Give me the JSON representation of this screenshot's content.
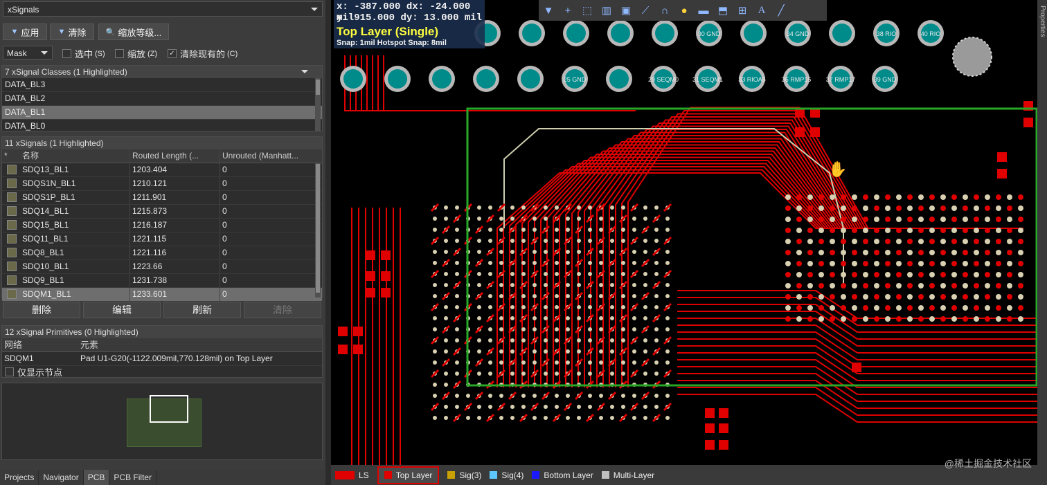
{
  "panel": {
    "title": "xSignals",
    "apply_label": "应用",
    "clear_label": "清除",
    "zoom_label": "缩放等级...",
    "mask_value": "Mask",
    "select_label": "选中",
    "select_key": "(S)",
    "zoom_check_label": "缩放",
    "zoom_key": "(Z)",
    "clear_existing_label": "清除现有的",
    "clear_existing_key": "(C)"
  },
  "classes": {
    "header": "7 xSignal Classes (1 Highlighted)",
    "items": [
      "DATA_BL3",
      "DATA_BL2",
      "DATA_BL1",
      "DATA_BL0"
    ],
    "selected": "DATA_BL1"
  },
  "signals": {
    "header": "11 xSignals (1 Highlighted)",
    "columns": [
      "*",
      "名称",
      "Routed Length (...",
      "Unrouted (Manhatt..."
    ],
    "rows": [
      {
        "name": "SDQ13_BL1",
        "routed": "1203.404",
        "unrouted": "0"
      },
      {
        "name": "SDQS1N_BL1",
        "routed": "1210.121",
        "unrouted": "0"
      },
      {
        "name": "SDQS1P_BL1",
        "routed": "1211.901",
        "unrouted": "0"
      },
      {
        "name": "SDQ14_BL1",
        "routed": "1215.873",
        "unrouted": "0"
      },
      {
        "name": "SDQ15_BL1",
        "routed": "1216.187",
        "unrouted": "0"
      },
      {
        "name": "SDQ11_BL1",
        "routed": "1221.115",
        "unrouted": "0"
      },
      {
        "name": "SDQ8_BL1",
        "routed": "1221.116",
        "unrouted": "0"
      },
      {
        "name": "SDQ10_BL1",
        "routed": "1223.66",
        "unrouted": "0"
      },
      {
        "name": "SDQ9_BL1",
        "routed": "1231.738",
        "unrouted": "0"
      },
      {
        "name": "SDQM1_BL1",
        "routed": "1233.601",
        "unrouted": "0"
      }
    ],
    "selected": "SDQM1_BL1"
  },
  "actions": {
    "delete": "删除",
    "edit": "编辑",
    "refresh": "刷新",
    "clear": "清除"
  },
  "primitives": {
    "header": "12 xSignal Primitives (0 Highlighted)",
    "col_net": "网络",
    "col_element": "元素",
    "net": "SDQM1",
    "element": "Pad U1-G20(-1122.009mil,770.128mil) on Top Layer",
    "show_nodes_label": "仅显示节点"
  },
  "bottom_tabs": [
    "Projects",
    "Navigator",
    "PCB",
    "PCB Filter"
  ],
  "active_tab": "PCB",
  "coords": {
    "x_label": "x:",
    "x": "-387.000",
    "dx_label": "dx:",
    "dx": "-24.000 mil",
    "y_label": "y:",
    "y": "915.000",
    "dy_label": "dy:",
    "dy": "13.000 mil",
    "layer": "Top Layer (Single)",
    "snap": "Snap: 1mil Hotspot Snap: 8mil"
  },
  "toolbar_icons": [
    "filter-icon",
    "cross-icon",
    "select-rect-icon",
    "chart-icon",
    "chip-icon",
    "route-icon",
    "diff-pair-icon",
    "pin-icon",
    "fill-icon",
    "polygon-icon",
    "dimension-icon",
    "text-icon",
    "line-icon"
  ],
  "properties_label": "Properties",
  "pads_row1": [
    "",
    "",
    "",
    "",
    "",
    "30 GND",
    "",
    "34 GND",
    "",
    "38 RIO",
    "40 RIO"
  ],
  "pads_row2": [
    "",
    "",
    "",
    "",
    "",
    "25 GND",
    "",
    "29 SEQM0",
    "31 SEQM1",
    "33 RIOA5",
    "36 RMP15",
    "37 RMP17",
    "39 GND"
  ],
  "layers": [
    {
      "name": "LS",
      "color": "#e00000"
    },
    {
      "name": "Top Layer",
      "color": "#e00000"
    },
    {
      "name": "Sig(3)",
      "color": "#c8a000"
    },
    {
      "name": "Sig(4)",
      "color": "#5cc8ff"
    },
    {
      "name": "Bottom Layer",
      "color": "#1a1aff"
    },
    {
      "name": "Multi-Layer",
      "color": "#c0c0c0"
    }
  ],
  "active_layer": "Top Layer",
  "watermark": "@稀土掘金技术社区",
  "colors": {
    "trace": "#e00000",
    "board_outline": "#27a827",
    "pad": "#b8b8b8",
    "pad_center": "#008b8b"
  }
}
